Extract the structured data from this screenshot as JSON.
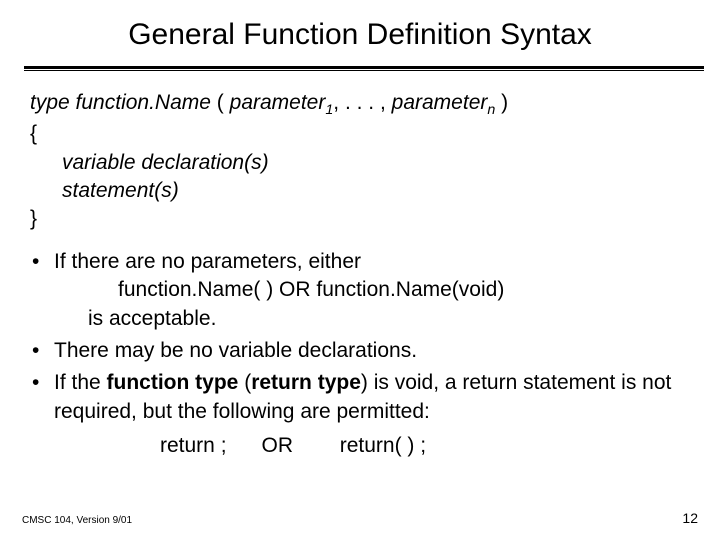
{
  "title": "General Function Definition Syntax",
  "syntax": {
    "type": "type",
    "funcName": "function.Name",
    "open": "(",
    "param": "parameter",
    "sub1": "1",
    "sep": ", . . . ,",
    "subN": "n",
    "close": ")",
    "lbrace": "{",
    "varDecl": "variable declaration(s)",
    "stmt": "statement(s)",
    "rbrace": "}"
  },
  "bullets": {
    "b1": "If there are no parameters, either",
    "b1sub": "function.Name( )   OR   function.Name(void)",
    "b1tail": "is acceptable.",
    "b2": "There may be no variable declarations.",
    "b3a": "If the ",
    "b3b": "function type",
    "b3c": " (",
    "b3d": "return type",
    "b3e": ") is void, a return statement is not required, but the following are permitted:"
  },
  "returnLine": {
    "r1": "return ;",
    "or": "OR",
    "r2": "return( ) ;"
  },
  "footer": {
    "left": "CMSC 104, Version 9/01",
    "right": "12"
  }
}
